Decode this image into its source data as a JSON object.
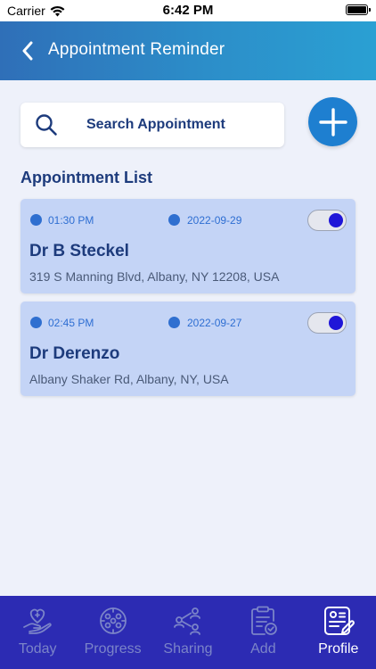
{
  "status_bar": {
    "carrier": "Carrier",
    "time": "6:42 PM"
  },
  "header": {
    "title": "Appointment Reminder"
  },
  "search": {
    "placeholder": "Search Appointment"
  },
  "section": {
    "title": "Appointment List"
  },
  "appointments": [
    {
      "time": "01:30 PM",
      "date": "2022-09-29",
      "doctor": "Dr B Steckel",
      "address": "319 S Manning Blvd, Albany, NY 12208, USA",
      "reminder_on": true
    },
    {
      "time": "02:45 PM",
      "date": "2022-09-27",
      "doctor": "Dr Derenzo",
      "address": "Albany Shaker Rd, Albany, NY, USA",
      "reminder_on": true
    }
  ],
  "tabs": [
    {
      "label": "Today",
      "icon": "heart-hand-icon",
      "active": false
    },
    {
      "label": "Progress",
      "icon": "progress-people-icon",
      "active": false
    },
    {
      "label": "Sharing",
      "icon": "sharing-people-icon",
      "active": false
    },
    {
      "label": "Add",
      "icon": "clipboard-check-icon",
      "active": false
    },
    {
      "label": "Profile",
      "icon": "profile-edit-icon",
      "active": true
    }
  ],
  "colors": {
    "header_gradient_start": "#2f6fb8",
    "header_gradient_end": "#2aa0d3",
    "accent": "#1e7fd0",
    "card_bg": "#c4d4f6",
    "tab_bar_bg": "#2c2bb3",
    "title_text": "#1d3b7c"
  }
}
